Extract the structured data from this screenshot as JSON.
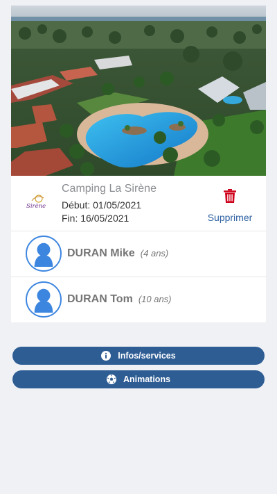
{
  "booking": {
    "camping_name": "Camping La Sirène",
    "logo_text": "Sirène",
    "start_date": "Début: 01/05/2021",
    "end_date": "Fin: 16/05/2021",
    "delete_label": "Supprimer"
  },
  "children": [
    {
      "name": "DURAN Mike",
      "age": "(4 ans)"
    },
    {
      "name": "DURAN Tom",
      "age": "(10 ans)"
    }
  ],
  "actions": {
    "info_label": "Infos/services",
    "animations_label": "Animations"
  },
  "colors": {
    "primary_button": "#2e5d94",
    "link_blue": "#2d61a3",
    "delete_red": "#d0021b",
    "avatar_blue": "#3d86e0"
  },
  "icons": {
    "delete": "trash-icon",
    "avatar": "child-avatar-icon",
    "info": "info-circle-icon",
    "animations": "soccer-ball-icon"
  }
}
